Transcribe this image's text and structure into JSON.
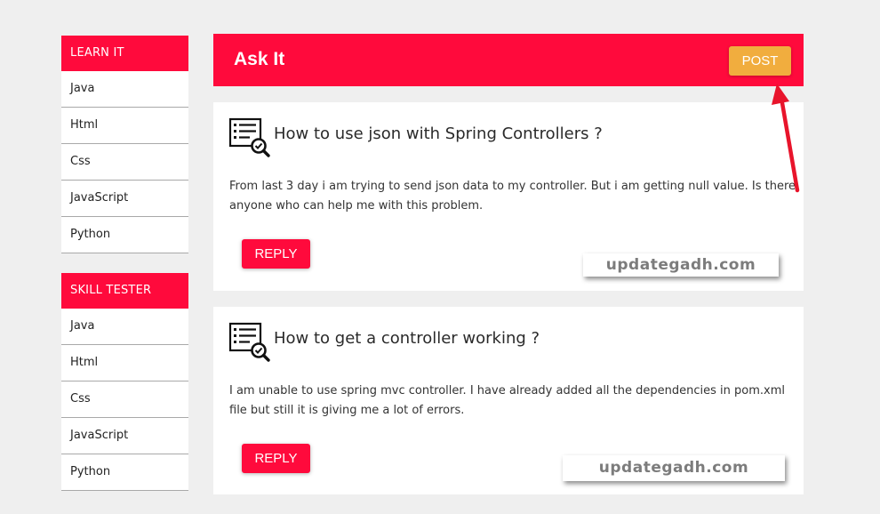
{
  "sidebar": {
    "sections": [
      {
        "title": "LEARN IT",
        "items": [
          "Java",
          "Html",
          "Css",
          "JavaScript",
          "Python"
        ]
      },
      {
        "title": "SKILL TESTER",
        "items": [
          "Java",
          "Html",
          "Css",
          "JavaScript",
          "Python"
        ]
      }
    ]
  },
  "header": {
    "title": "Ask It",
    "post_label": "POST"
  },
  "questions": [
    {
      "title": "How to use json with Spring Controllers ?",
      "body": "From last 3 day i am trying to send json data to my controller. But i am getting null value. Is there anyone who can help me with this problem.",
      "reply_label": "REPLY"
    },
    {
      "title": "How to get a controller working ?",
      "body": "I am unable to use spring mvc controller. I have already added all the dependencies in pom.xml file but still it is giving me a lot of errors.",
      "reply_label": "REPLY"
    }
  ],
  "watermarks": [
    "updategadh.com",
    "updategadh.com"
  ],
  "colors": {
    "accent": "#ff0a3c",
    "post_button": "#f1ad3e",
    "background": "#efefef"
  },
  "icons": {
    "question": "list-search-icon",
    "pointer": "red-arrow-icon"
  }
}
